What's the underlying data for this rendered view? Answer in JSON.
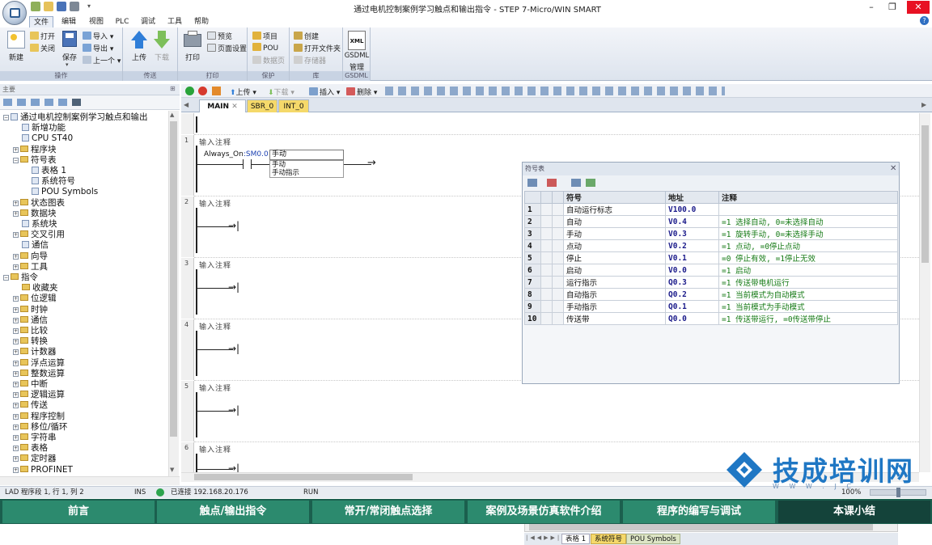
{
  "window": {
    "title": "通过电机控制案例学习触点和输出指令 - STEP 7-Micro/WIN SMART",
    "minimize": "–",
    "restore": "❐",
    "close": "✕"
  },
  "menu_tabs": [
    "文件",
    "编辑",
    "视图",
    "PLC",
    "调试",
    "工具",
    "帮助"
  ],
  "ribbon": {
    "groups": {
      "ops": "操作",
      "transfer": "传送",
      "print": "打印",
      "protect": "保护",
      "lib": "库",
      "gsdml": "GSDML"
    },
    "new_label": "新建",
    "open_label": "打开",
    "close_label": "关闭",
    "save_label": "保存",
    "import_label": "导入",
    "export_label": "导出",
    "previous_label": "上一个",
    "upload_label": "上传",
    "download_label": "下载",
    "print_label": "打印",
    "preview_label": "预览",
    "page_setup_label": "页面设置",
    "project_label": "项目",
    "pou_label": "POU",
    "datapage_label": "数据页",
    "create_label": "创建",
    "open_folder_label": "打开文件夹",
    "memory_label": "存储器",
    "gsdml_label": "GSDML",
    "gsdml_manage_label": "管理",
    "xml_badge": "XML"
  },
  "left_panel": {
    "header": "主要",
    "tree": [
      {
        "label": "通过电机控制案例学习触点和输出",
        "level": 0,
        "expand": "-",
        "icon": "doc"
      },
      {
        "label": "新增功能",
        "level": 1,
        "expand": "",
        "icon": "doc"
      },
      {
        "label": "CPU ST40",
        "level": 1,
        "expand": "",
        "icon": "doc"
      },
      {
        "label": "程序块",
        "level": 1,
        "expand": "+",
        "icon": "folder"
      },
      {
        "label": "符号表",
        "level": 1,
        "expand": "-",
        "icon": "folder"
      },
      {
        "label": "表格 1",
        "level": 2,
        "expand": "",
        "icon": "doc"
      },
      {
        "label": "系统符号",
        "level": 2,
        "expand": "",
        "icon": "doc"
      },
      {
        "label": "POU Symbols",
        "level": 2,
        "expand": "",
        "icon": "doc"
      },
      {
        "label": "状态图表",
        "level": 1,
        "expand": "+",
        "icon": "folder"
      },
      {
        "label": "数据块",
        "level": 1,
        "expand": "+",
        "icon": "folder"
      },
      {
        "label": "系统块",
        "level": 1,
        "expand": "",
        "icon": "doc"
      },
      {
        "label": "交叉引用",
        "level": 1,
        "expand": "+",
        "icon": "folder"
      },
      {
        "label": "通信",
        "level": 1,
        "expand": "",
        "icon": "doc"
      },
      {
        "label": "向导",
        "level": 1,
        "expand": "+",
        "icon": "folder"
      },
      {
        "label": "工具",
        "level": 1,
        "expand": "+",
        "icon": "folder"
      },
      {
        "label": "指令",
        "level": 0,
        "expand": "-",
        "icon": "folder"
      },
      {
        "label": "收藏夹",
        "level": 1,
        "expand": "",
        "icon": "folder"
      },
      {
        "label": "位逻辑",
        "level": 1,
        "expand": "+",
        "icon": "folder"
      },
      {
        "label": "时钟",
        "level": 1,
        "expand": "+",
        "icon": "folder"
      },
      {
        "label": "通信",
        "level": 1,
        "expand": "+",
        "icon": "folder"
      },
      {
        "label": "比较",
        "level": 1,
        "expand": "+",
        "icon": "folder"
      },
      {
        "label": "转换",
        "level": 1,
        "expand": "+",
        "icon": "folder"
      },
      {
        "label": "计数器",
        "level": 1,
        "expand": "+",
        "icon": "folder"
      },
      {
        "label": "浮点运算",
        "level": 1,
        "expand": "+",
        "icon": "folder"
      },
      {
        "label": "整数运算",
        "level": 1,
        "expand": "+",
        "icon": "folder"
      },
      {
        "label": "中断",
        "level": 1,
        "expand": "+",
        "icon": "folder"
      },
      {
        "label": "逻辑运算",
        "level": 1,
        "expand": "+",
        "icon": "folder"
      },
      {
        "label": "传送",
        "level": 1,
        "expand": "+",
        "icon": "folder"
      },
      {
        "label": "程序控制",
        "level": 1,
        "expand": "+",
        "icon": "folder"
      },
      {
        "label": "移位/循环",
        "level": 1,
        "expand": "+",
        "icon": "folder"
      },
      {
        "label": "字符串",
        "level": 1,
        "expand": "+",
        "icon": "folder"
      },
      {
        "label": "表格",
        "level": 1,
        "expand": "+",
        "icon": "folder"
      },
      {
        "label": "定时器",
        "level": 1,
        "expand": "+",
        "icon": "folder"
      },
      {
        "label": "PROFINET",
        "level": 1,
        "expand": "+",
        "icon": "folder"
      }
    ]
  },
  "editor": {
    "toolbar": {
      "upload": "上传",
      "download": "下载",
      "insert": "插入",
      "delete": "删除"
    },
    "tabs": [
      "MAIN",
      "SBR_0",
      "INT_0"
    ],
    "tab_close": "✕",
    "networks": [
      {
        "num": "1",
        "comment": "输入注释"
      },
      {
        "num": "2",
        "comment": "输入注释"
      },
      {
        "num": "3",
        "comment": "输入注释"
      },
      {
        "num": "4",
        "comment": "输入注释"
      },
      {
        "num": "5",
        "comment": "输入注释"
      },
      {
        "num": "6",
        "comment": "输入注释"
      }
    ],
    "contact_symbol": "Always_On",
    "contact_addr": ":SM0.0",
    "coil_input": "手动",
    "autocomplete": [
      "手动",
      "手动指示"
    ]
  },
  "symbol_table": {
    "title": "符号表",
    "columns": [
      "符号",
      "地址",
      "注释"
    ],
    "rows": [
      {
        "n": "1",
        "sym": "自动运行标志",
        "addr": "V100.0",
        "cmt": ""
      },
      {
        "n": "2",
        "sym": "自动",
        "addr": "V0.4",
        "cmt": "=1 选择自动, 0=未选择自动"
      },
      {
        "n": "3",
        "sym": "手动",
        "addr": "V0.3",
        "cmt": "=1 旋转手动, 0=未选择手动"
      },
      {
        "n": "4",
        "sym": "点动",
        "addr": "V0.2",
        "cmt": "=1 点动, =0停止点动"
      },
      {
        "n": "5",
        "sym": "停止",
        "addr": "V0.1",
        "cmt": "=0 停止有效, =1停止无效"
      },
      {
        "n": "6",
        "sym": "启动",
        "addr": "V0.0",
        "cmt": "=1 启动"
      },
      {
        "n": "7",
        "sym": "运行指示",
        "addr": "Q0.3",
        "cmt": "=1 传送带电机运行"
      },
      {
        "n": "8",
        "sym": "自动指示",
        "addr": "Q0.2",
        "cmt": "=1 当前模式为自动模式"
      },
      {
        "n": "9",
        "sym": "手动指示",
        "addr": "Q0.1",
        "cmt": "=1 当前模式为手动模式"
      },
      {
        "n": "10",
        "sym": "传送带",
        "addr": "Q0.0",
        "cmt": "=1 传送带运行, =0传送带停止"
      }
    ],
    "tabs": [
      "表格 1",
      "系统符号",
      "POU Symbols"
    ]
  },
  "status_bar": {
    "position": "LAD 程序段 1, 行 1, 列 2",
    "mode": "INS",
    "connection": "已连接 192.168.20.176",
    "run": "RUN",
    "zoom": "100%"
  },
  "course_nav": [
    "前言",
    "触点/输出指令",
    "常开/常闭触点选择",
    "案例及场景仿真软件介绍",
    "程序的编写与调试",
    "本课小结"
  ],
  "watermark": {
    "text": "技成培训网",
    "url": "W W W . J C"
  },
  "colors": {
    "accent_green": "#2c8a6e",
    "course_bar": "#1b5f4e",
    "watermark_blue": "#1f77c4",
    "address_blue": "#1a1a8a",
    "comment_green": "#157a15"
  },
  "icons": {
    "app": "app-orb-icon",
    "help": "help-icon",
    "run": "run-icon",
    "stop": "stop-icon",
    "upload": "upload-arrow-icon",
    "download": "download-arrow-icon"
  }
}
